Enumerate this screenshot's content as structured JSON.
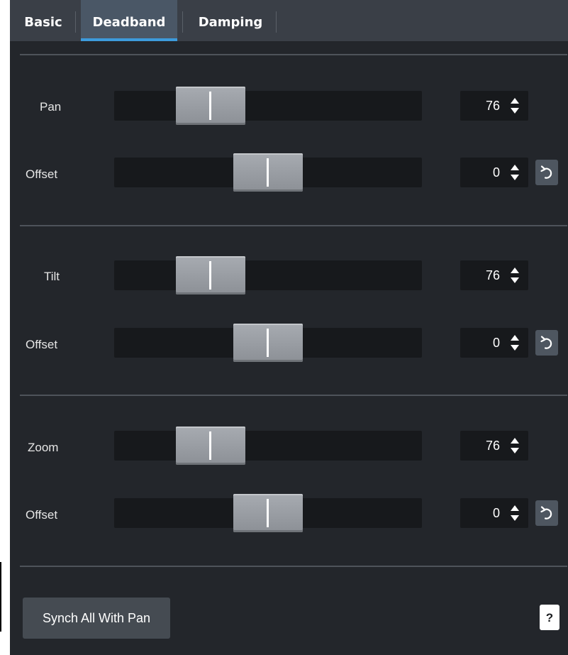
{
  "tabs": [
    {
      "label": "Basic",
      "active": false
    },
    {
      "label": "Deadband",
      "active": true
    },
    {
      "label": "Damping",
      "active": false
    }
  ],
  "sections": [
    {
      "main": {
        "label": "Pan",
        "value": "76",
        "slider_fraction": 0.26
      },
      "offset": {
        "label": "Offset",
        "value": "0",
        "slider_fraction": 0.5
      }
    },
    {
      "main": {
        "label": "Tilt",
        "value": "76",
        "slider_fraction": 0.26
      },
      "offset": {
        "label": "Offset",
        "value": "0",
        "slider_fraction": 0.5
      }
    },
    {
      "main": {
        "label": "Zoom",
        "value": "76",
        "slider_fraction": 0.26
      },
      "offset": {
        "label": "Offset",
        "value": "0",
        "slider_fraction": 0.5
      }
    }
  ],
  "footer": {
    "synch_label": "Synch All With Pan",
    "help_label": "?"
  },
  "icons": {
    "spinner": "up-down-arrows-icon",
    "reset": "reset-icon"
  },
  "colors": {
    "accent": "#3d9bdc",
    "panel_bg": "#23262b",
    "tabbar_bg": "#3a3f47"
  }
}
